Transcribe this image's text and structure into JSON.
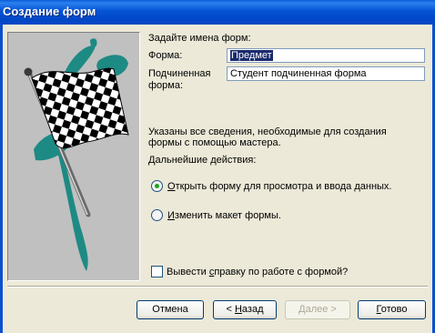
{
  "window": {
    "title": "Создание форм"
  },
  "form": {
    "heading": "Задайте имена форм:",
    "main_label": "Форма:",
    "main_value": "Предмет",
    "sub_label_line1": "Подчиненная",
    "sub_label_line2": "форма:",
    "sub_value": "Студент подчиненная форма"
  },
  "info": {
    "line1": "Указаны все сведения, необходимые для создания",
    "line2": "формы с помощью мастера.",
    "next_actions": "Дальнейшие действия:"
  },
  "options": {
    "open": {
      "hotkey": "О",
      "rest": "ткрыть форму для просмотра и ввода данных.",
      "selected": true
    },
    "modify": {
      "hotkey": "И",
      "rest": "зменить макет формы.",
      "selected": false
    }
  },
  "help_checkbox": {
    "before": "Вывести ",
    "hotkey": "с",
    "after": "правку по работе с формой?",
    "checked": false
  },
  "buttons": {
    "cancel": "Отмена",
    "back_prefix": "< ",
    "back_hotkey": "Н",
    "back_rest": "азад",
    "next": "Далее >",
    "finish_hotkey": "Г",
    "finish_rest": "отово"
  },
  "icons": {
    "picture": "checkered-flag-icon"
  },
  "colors": {
    "titlebar": "#0453d5",
    "selection": "#1a2a6c",
    "teal_accent": "#1e8a84",
    "radio_dot": "#21a121"
  }
}
